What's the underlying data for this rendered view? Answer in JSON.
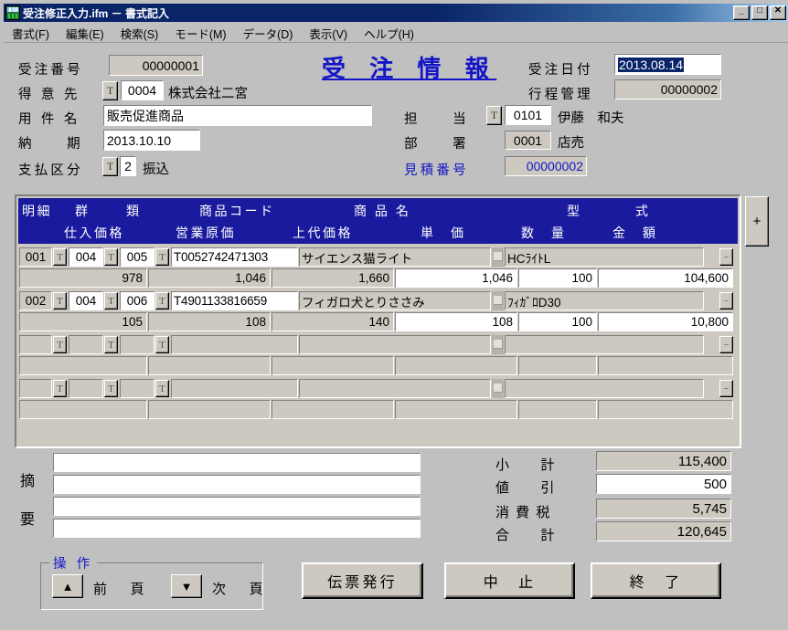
{
  "window": {
    "title": "受注修正入力.ifm － 書式記入",
    "icon": "form-document-icon",
    "minimize": "_",
    "maximize": "□",
    "close": "✕"
  },
  "menu": [
    {
      "label": "書式(F)",
      "name": "menu-format"
    },
    {
      "label": "編集(E)",
      "name": "menu-edit"
    },
    {
      "label": "検索(S)",
      "name": "menu-search"
    },
    {
      "label": "モード(M)",
      "name": "menu-mode"
    },
    {
      "label": "データ(D)",
      "name": "menu-data"
    },
    {
      "label": "表示(V)",
      "name": "menu-view"
    },
    {
      "label": "ヘルプ(H)",
      "name": "menu-help"
    }
  ],
  "form": {
    "title": "受 注 情 報",
    "order_no_label": "受注番号",
    "order_no_value": "00000001",
    "customer_label": "得 意 先",
    "customer_code": "0004",
    "customer_name": "株式会社二宮",
    "customer_lookup": "T",
    "subject_label": "用 件 名",
    "subject_value": "販売促進商品",
    "delivery_label": "納　　期",
    "delivery_value": "2013.10.10",
    "payment_label": "支払区分",
    "payment_code": "2",
    "payment_name": "振込",
    "payment_lookup": "T",
    "order_date_label": "受注日付",
    "order_date_value": "2013.08.14",
    "process_label": "行程管理",
    "process_value": "00000002",
    "staff_label": "担　　当",
    "staff_code": "0101",
    "staff_name": "伊藤　和夫",
    "staff_lookup": "T",
    "dept_label": "部　　署",
    "dept_code": "0001",
    "dept_name": "店売",
    "quote_label": "見積番号",
    "quote_value": "00000002"
  },
  "grid": {
    "add_row_button": "+",
    "headers_row1": [
      "明細",
      "群",
      "類",
      "商品コード",
      "商 品 名",
      "型",
      "式"
    ],
    "headers_row2": [
      "仕入価格",
      "営業原価",
      "上代価格",
      "単　価",
      "数　量",
      "金　額"
    ],
    "lookup_label": "T",
    "delete_label": "−",
    "rows": [
      {
        "no": "001",
        "group": "004",
        "kind": "005",
        "product_code": "T0052742471303",
        "product_name": "サイエンス猫ライト",
        "model": "HCﾗｲﾄL",
        "cost_price": "978",
        "operating_cost": "1,046",
        "list_price": "1,660",
        "unit_price": "1,046",
        "quantity": "100",
        "amount": "104,600"
      },
      {
        "no": "002",
        "group": "004",
        "kind": "006",
        "product_code": "T4901133816659",
        "product_name": "フィガロ犬とりささみ",
        "model": "ﾌｨｶﾞﾛD30",
        "cost_price": "105",
        "operating_cost": "108",
        "list_price": "140",
        "unit_price": "108",
        "quantity": "100",
        "amount": "10,800"
      },
      {
        "no": "",
        "group": "",
        "kind": "",
        "product_code": "",
        "product_name": "",
        "model": "",
        "cost_price": "",
        "operating_cost": "",
        "list_price": "",
        "unit_price": "",
        "quantity": "",
        "amount": ""
      },
      {
        "no": "",
        "group": "",
        "kind": "",
        "product_code": "",
        "product_name": "",
        "model": "",
        "cost_price": "",
        "operating_cost": "",
        "list_price": "",
        "unit_price": "",
        "quantity": "",
        "amount": ""
      }
    ]
  },
  "remarks": {
    "label_top": "摘",
    "label_bottom": "要",
    "lines": [
      "",
      "",
      "",
      ""
    ]
  },
  "totals": [
    {
      "label": "小　　計",
      "value": "115,400",
      "editable": false
    },
    {
      "label": "値　　引",
      "value": "500",
      "editable": true
    },
    {
      "label": "消 費 税",
      "value": "5,745",
      "editable": false
    },
    {
      "label": "合　　計",
      "value": "120,645",
      "editable": false
    }
  ],
  "operations": {
    "legend": "操 作",
    "prev_icon": "▲",
    "prev_label": "前　頁",
    "next_icon": "▼",
    "next_label": "次　頁"
  },
  "buttons": {
    "issue": "伝票発行",
    "cancel": "中　止",
    "exit": "終　了"
  },
  "colors": {
    "title_blue": "#1515c8",
    "grid_header": "#1a1a9e",
    "face": "#c0c0c0",
    "field_face": "#cdc9c0",
    "selection": "#0a246a"
  }
}
